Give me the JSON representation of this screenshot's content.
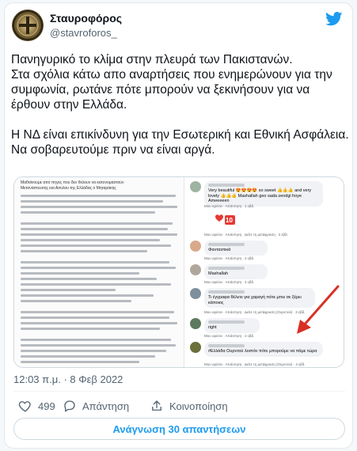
{
  "tweet": {
    "author_name": "Σταυροφόρος",
    "author_handle": "@stavroforos_",
    "text": "Πανηγυρικό το κλίμα στην πλευρά των Πακιστανών.\nΣτα σχόλια κάτω απο αναρτήσεις που ενημερώνουν για την συμφωνία, ρωτάνε πότε μπορούν να ξεκινήσουν για να έρθουν στην Ελλάδα.\n\nΗ ΝΔ είναι επικίνδυνη για την Εσωτερική και Εθνική Ασφάλεια.\nΝα σοβαρευτούμε πριν να είναι αργά.",
    "timestamp": "12:03 π.μ. · 8 Φεβ 2022",
    "likes": "499",
    "reply_label": "Απάντηση",
    "share_label": "Κοινοποίηση",
    "read_replies_label": "Ανάγνωση 30 απαντήσεων"
  },
  "media": {
    "document_excerpt": {
      "line1": "Μαθαίνουμε από πηγές που δεν θέλουν να κατονομαστούν",
      "line2": "Μετανάστευσης και Ασύλου της Ελλάδας ο Μηταράκης"
    },
    "comments": [
      {
        "text": "Very beautiful 😍😍😍😍 so sweet 👍👍👍 and very lovely 👍👍👍 Mashallah geo sada zendgi hoye Ameeeeen",
        "actions": "Μου αρέσει · Απάντηση · 1 εβδ."
      },
      {
        "text": "",
        "actions": "Μου αρέσει · Απάντηση · Δείτε τη μετάφραση · 2 εβδ."
      },
      {
        "text": "Φανταστικά",
        "actions": "Μου αρέσει · Απάντηση · 2 εβδ."
      },
      {
        "text": "Mashallah",
        "actions": "Μου αρέσει · Απάντηση · 2 εβδ."
      },
      {
        "text": "Τι έγγραφα θέλετε για χαραγή πότε μπει σε ξέρει κάποιος",
        "actions": "Μου αρέσει · Απάντηση · Δείτε τη μετάφραση (Ουρντού) · 2 εβδ."
      },
      {
        "text": "right",
        "actions": "Μου αρέσει · Απάντηση · 2 εβδ."
      },
      {
        "text": "#Ελλάδα Ουρντού λοιπόν πότε μπορούμε να πάμε τώρα",
        "actions": "Μου αρέσει · Απάντηση · Δείτε τη μετάφραση (Ουρντού) · 4 εβδ."
      }
    ],
    "sticker_number": "10"
  },
  "colors": {
    "twitter_blue": "#1d9bf0",
    "secondary_text": "#536471",
    "annotation_arrow": "#d93025"
  }
}
